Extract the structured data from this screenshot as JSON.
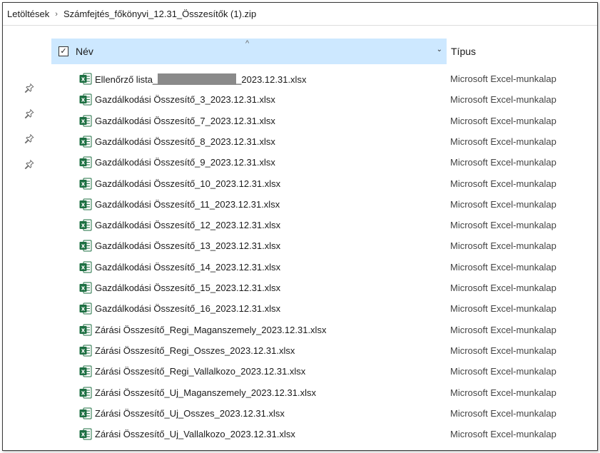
{
  "breadcrumb": {
    "root": "Letöltések",
    "separator": "›",
    "current": "Számfejtés_főkönyvi_12.31_Összesítők (1).zip"
  },
  "columns": {
    "name": "Név",
    "type": "Típus",
    "sort_caret": "^",
    "dropdown": "⌄",
    "check": "✓"
  },
  "files": [
    {
      "name_before": "Ellenőrző lista_",
      "name_after": "_2023.12.31.xlsx",
      "redacted": true,
      "type": "Microsoft Excel-munkalap"
    },
    {
      "name": "Gazdálkodási Összesítő_3_2023.12.31.xlsx",
      "type": "Microsoft Excel-munkalap"
    },
    {
      "name": "Gazdálkodási Összesítő_7_2023.12.31.xlsx",
      "type": "Microsoft Excel-munkalap"
    },
    {
      "name": "Gazdálkodási Összesítő_8_2023.12.31.xlsx",
      "type": "Microsoft Excel-munkalap"
    },
    {
      "name": "Gazdálkodási Összesítő_9_2023.12.31.xlsx",
      "type": "Microsoft Excel-munkalap"
    },
    {
      "name": "Gazdálkodási Összesítő_10_2023.12.31.xlsx",
      "type": "Microsoft Excel-munkalap"
    },
    {
      "name": "Gazdálkodási Összesítő_11_2023.12.31.xlsx",
      "type": "Microsoft Excel-munkalap"
    },
    {
      "name": "Gazdálkodási Összesítő_12_2023.12.31.xlsx",
      "type": "Microsoft Excel-munkalap"
    },
    {
      "name": "Gazdálkodási Összesítő_13_2023.12.31.xlsx",
      "type": "Microsoft Excel-munkalap"
    },
    {
      "name": "Gazdálkodási Összesítő_14_2023.12.31.xlsx",
      "type": "Microsoft Excel-munkalap"
    },
    {
      "name": "Gazdálkodási Összesítő_15_2023.12.31.xlsx",
      "type": "Microsoft Excel-munkalap"
    },
    {
      "name": "Gazdálkodási Összesítő_16_2023.12.31.xlsx",
      "type": "Microsoft Excel-munkalap"
    },
    {
      "name": "Zárási Összesítő_Regi_Maganszemely_2023.12.31.xlsx",
      "type": "Microsoft Excel-munkalap"
    },
    {
      "name": "Zárási Összesítő_Regi_Osszes_2023.12.31.xlsx",
      "type": "Microsoft Excel-munkalap"
    },
    {
      "name": "Zárási Összesítő_Regi_Vallalkozo_2023.12.31.xlsx",
      "type": "Microsoft Excel-munkalap"
    },
    {
      "name": "Zárási Összesítő_Uj_Maganszemely_2023.12.31.xlsx",
      "type": "Microsoft Excel-munkalap"
    },
    {
      "name": "Zárási Összesítő_Uj_Osszes_2023.12.31.xlsx",
      "type": "Microsoft Excel-munkalap"
    },
    {
      "name": "Zárási Összesítő_Uj_Vallalkozo_2023.12.31.xlsx",
      "type": "Microsoft Excel-munkalap"
    }
  ],
  "icons": {
    "file": "excel-file-icon",
    "pin": "pin-icon"
  },
  "pinned_count": 4,
  "colors": {
    "header_highlight": "#cde8ff",
    "excel_green": "#1d6f42"
  }
}
